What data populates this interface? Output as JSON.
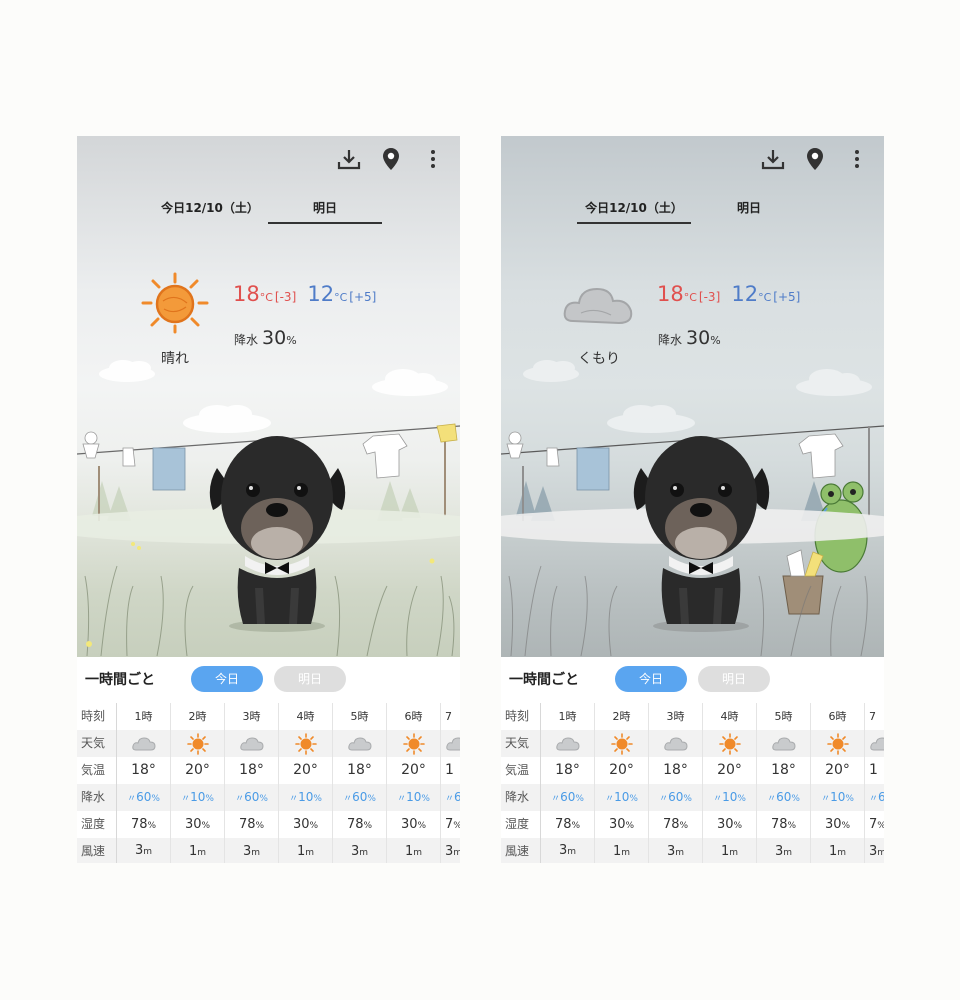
{
  "screens": [
    {
      "id": "today",
      "tabs": {
        "today": "今日12/10（土）",
        "tomorrow": "明日",
        "active": "tomorrow"
      },
      "weather": {
        "icon": "sun-icon",
        "label": "晴れ"
      },
      "temps": {
        "high": "18",
        "high_unit": "°C",
        "high_diff": "[-3]",
        "low": "12",
        "low_unit": "°C",
        "low_diff": "[+5]"
      },
      "precip": {
        "label": "降水",
        "value": "30",
        "unit": "%"
      },
      "scene": "sunny"
    },
    {
      "id": "tomorrow",
      "tabs": {
        "today": "今日12/10（土）",
        "tomorrow": "明日",
        "active": "today"
      },
      "weather": {
        "icon": "cloud-icon",
        "label": "くもり"
      },
      "temps": {
        "high": "18",
        "high_unit": "°C",
        "high_diff": "[-3]",
        "low": "12",
        "low_unit": "°C",
        "low_diff": "[+5]"
      },
      "precip": {
        "label": "降水",
        "value": "30",
        "unit": "%"
      },
      "scene": "cloudy"
    }
  ],
  "hourly": {
    "title": "一時間ごと",
    "today_btn": "今日",
    "tomorrow_btn": "明日",
    "row_labels": [
      "時刻",
      "天気",
      "気温",
      "降水",
      "湿度",
      "風速"
    ],
    "times": [
      "1時",
      "2時",
      "3時",
      "4時",
      "5時",
      "6時",
      "7"
    ],
    "weather_icons": [
      "cloud-icon",
      "sun-icon",
      "cloud-icon",
      "sun-icon",
      "cloud-icon",
      "sun-icon",
      "cloud-icon"
    ],
    "temps": [
      "18°",
      "20°",
      "18°",
      "20°",
      "18°",
      "20°",
      "1"
    ],
    "rain": [
      "60",
      "10",
      "60",
      "10",
      "60",
      "10",
      "6"
    ],
    "rain_unit": "%",
    "humidity": [
      "78",
      "30",
      "78",
      "30",
      "78",
      "30",
      "7"
    ],
    "humidity_unit": "%",
    "wind": [
      "3",
      "1",
      "3",
      "1",
      "3",
      "1",
      "3"
    ],
    "wind_unit": "m"
  },
  "colors": {
    "accent": "#5aa5f0",
    "high_temp": "#e0504e",
    "low_temp": "#4f7cc8",
    "rain": "#4a9be6",
    "sun": "#f08a2a"
  }
}
